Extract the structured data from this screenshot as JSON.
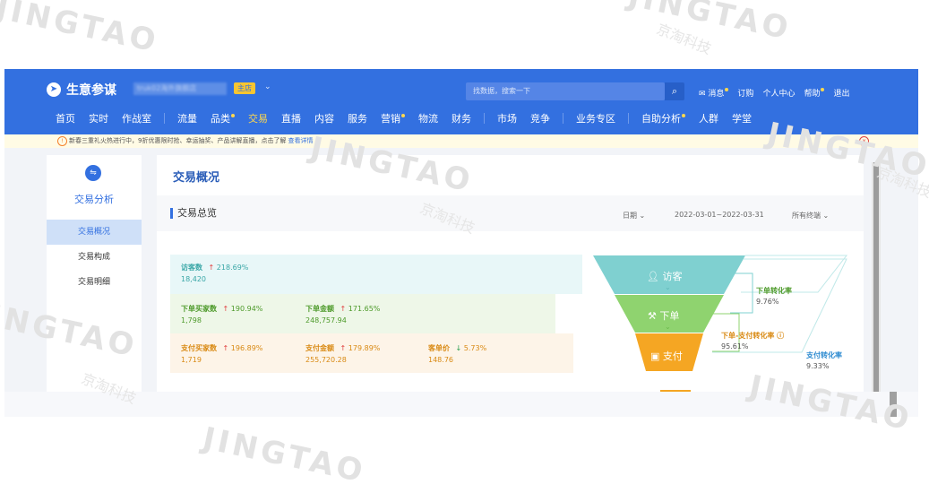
{
  "app": {
    "title": "生意参谋",
    "shop_name": "truk02海外旗舰店",
    "shop_badge": "主店",
    "shop_caret": "⌄",
    "search_placeholder": "找数据，搜索一下",
    "top_links": [
      "消息",
      "订购",
      "个人中心",
      "帮助",
      "退出"
    ]
  },
  "nav": {
    "group1": [
      "首页",
      "实时",
      "作战室"
    ],
    "group2": [
      "流量",
      "品类",
      "交易",
      "直播",
      "内容",
      "服务",
      "营销",
      "物流",
      "财务"
    ],
    "group3": [
      "市场",
      "竞争"
    ],
    "group4": [
      "业务专区"
    ],
    "group5": [
      "自助分析",
      "人群",
      "学堂"
    ],
    "active": "交易"
  },
  "notice": {
    "text": "新春三重礼火热进行中，9折优惠限时抢、幸运抽奖、产品讲解直播，点击了解",
    "link": "查看详情"
  },
  "sidebar": {
    "title": "交易分析",
    "items": [
      "交易概况",
      "交易构成",
      "交易明细"
    ]
  },
  "main": {
    "page_title": "交易概况",
    "section_title": "交易总览",
    "date_label": "日期",
    "date_range": "2022-03-01~2022-03-31",
    "terminal": "所有终端"
  },
  "metrics": {
    "visitors": {
      "label": "访客数",
      "change": "218.69%",
      "value": "18,420"
    },
    "order_buyers": {
      "label": "下单买家数",
      "change": "190.94%",
      "value": "1,798"
    },
    "order_amount": {
      "label": "下单金额",
      "change": "171.65%",
      "value": "248,757.94"
    },
    "pay_buyers": {
      "label": "支付买家数",
      "change": "196.89%",
      "value": "1,719"
    },
    "pay_amount": {
      "label": "支付金额",
      "change": "179.89%",
      "value": "255,720.28"
    },
    "unit_price": {
      "label": "客单价",
      "change": "5.73%",
      "value": "148.76"
    }
  },
  "funnel": {
    "stages": [
      "访客",
      "下单",
      "支付"
    ],
    "rates": {
      "order_conv": {
        "label": "下单转化率",
        "value": "9.76%"
      },
      "order_pay_conv": {
        "label": "下单-支付转化率",
        "value": "95.61%"
      },
      "pay_conv": {
        "label": "支付转化率",
        "value": "9.33%"
      }
    },
    "colors": {
      "visitor": "#7fd0d0",
      "order": "#8fd36f",
      "pay": "#f5a623"
    }
  },
  "watermark": {
    "brand": "JINGTAO",
    "cn": "京淘科技"
  }
}
